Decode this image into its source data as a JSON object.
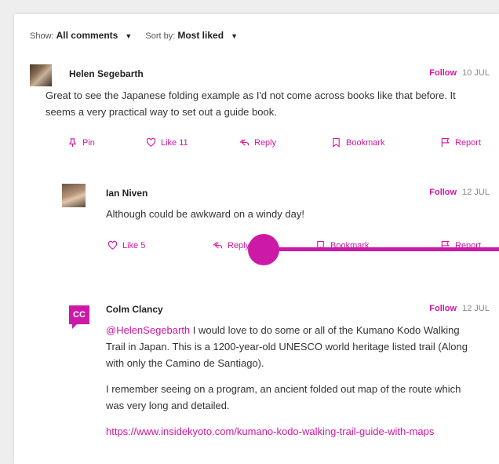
{
  "filter": {
    "show_label": "Show:",
    "show_value": "All comments",
    "sort_label": "Sort by:",
    "sort_value": "Most liked"
  },
  "comments": [
    {
      "author": "Helen Segebarth",
      "follow": "Follow",
      "date": "10 JUL",
      "text": "Great to see the Japanese folding example as I'd not come across books like that before. It seems a very practical way to set out a guide book.",
      "actions": {
        "pin": "Pin",
        "like": "Like 11",
        "reply": "Reply",
        "bookmark": "Bookmark",
        "report": "Report"
      }
    },
    {
      "author": "Ian Niven",
      "follow": "Follow",
      "date": "12 JUL",
      "text": "Although could be awkward on a windy day!",
      "actions": {
        "like": "Like 5",
        "reply": "Reply",
        "bookmark": "Bookmark",
        "report": "Report"
      }
    },
    {
      "author": "Colm Clancy",
      "avatar_initials": "CC",
      "follow": "Follow",
      "date": "12 JUL",
      "mention": "@HelenSegebarth",
      "text1": " I would love to do some or all of the Kumano Kodo Walking Trail in Japan. This is a 1200-year-old UNESCO world heritage listed trail (Along with only the Camino de Santiago).",
      "text2": "I remember seeing on a program, an ancient folded out map of the route which was very long and detailed.",
      "link": "https://www.insidekyoto.com/kumano-kodo-walking-trail-guide-with-maps"
    }
  ],
  "colors": {
    "accent": "#cc1aa7",
    "link": "#d0169f"
  }
}
